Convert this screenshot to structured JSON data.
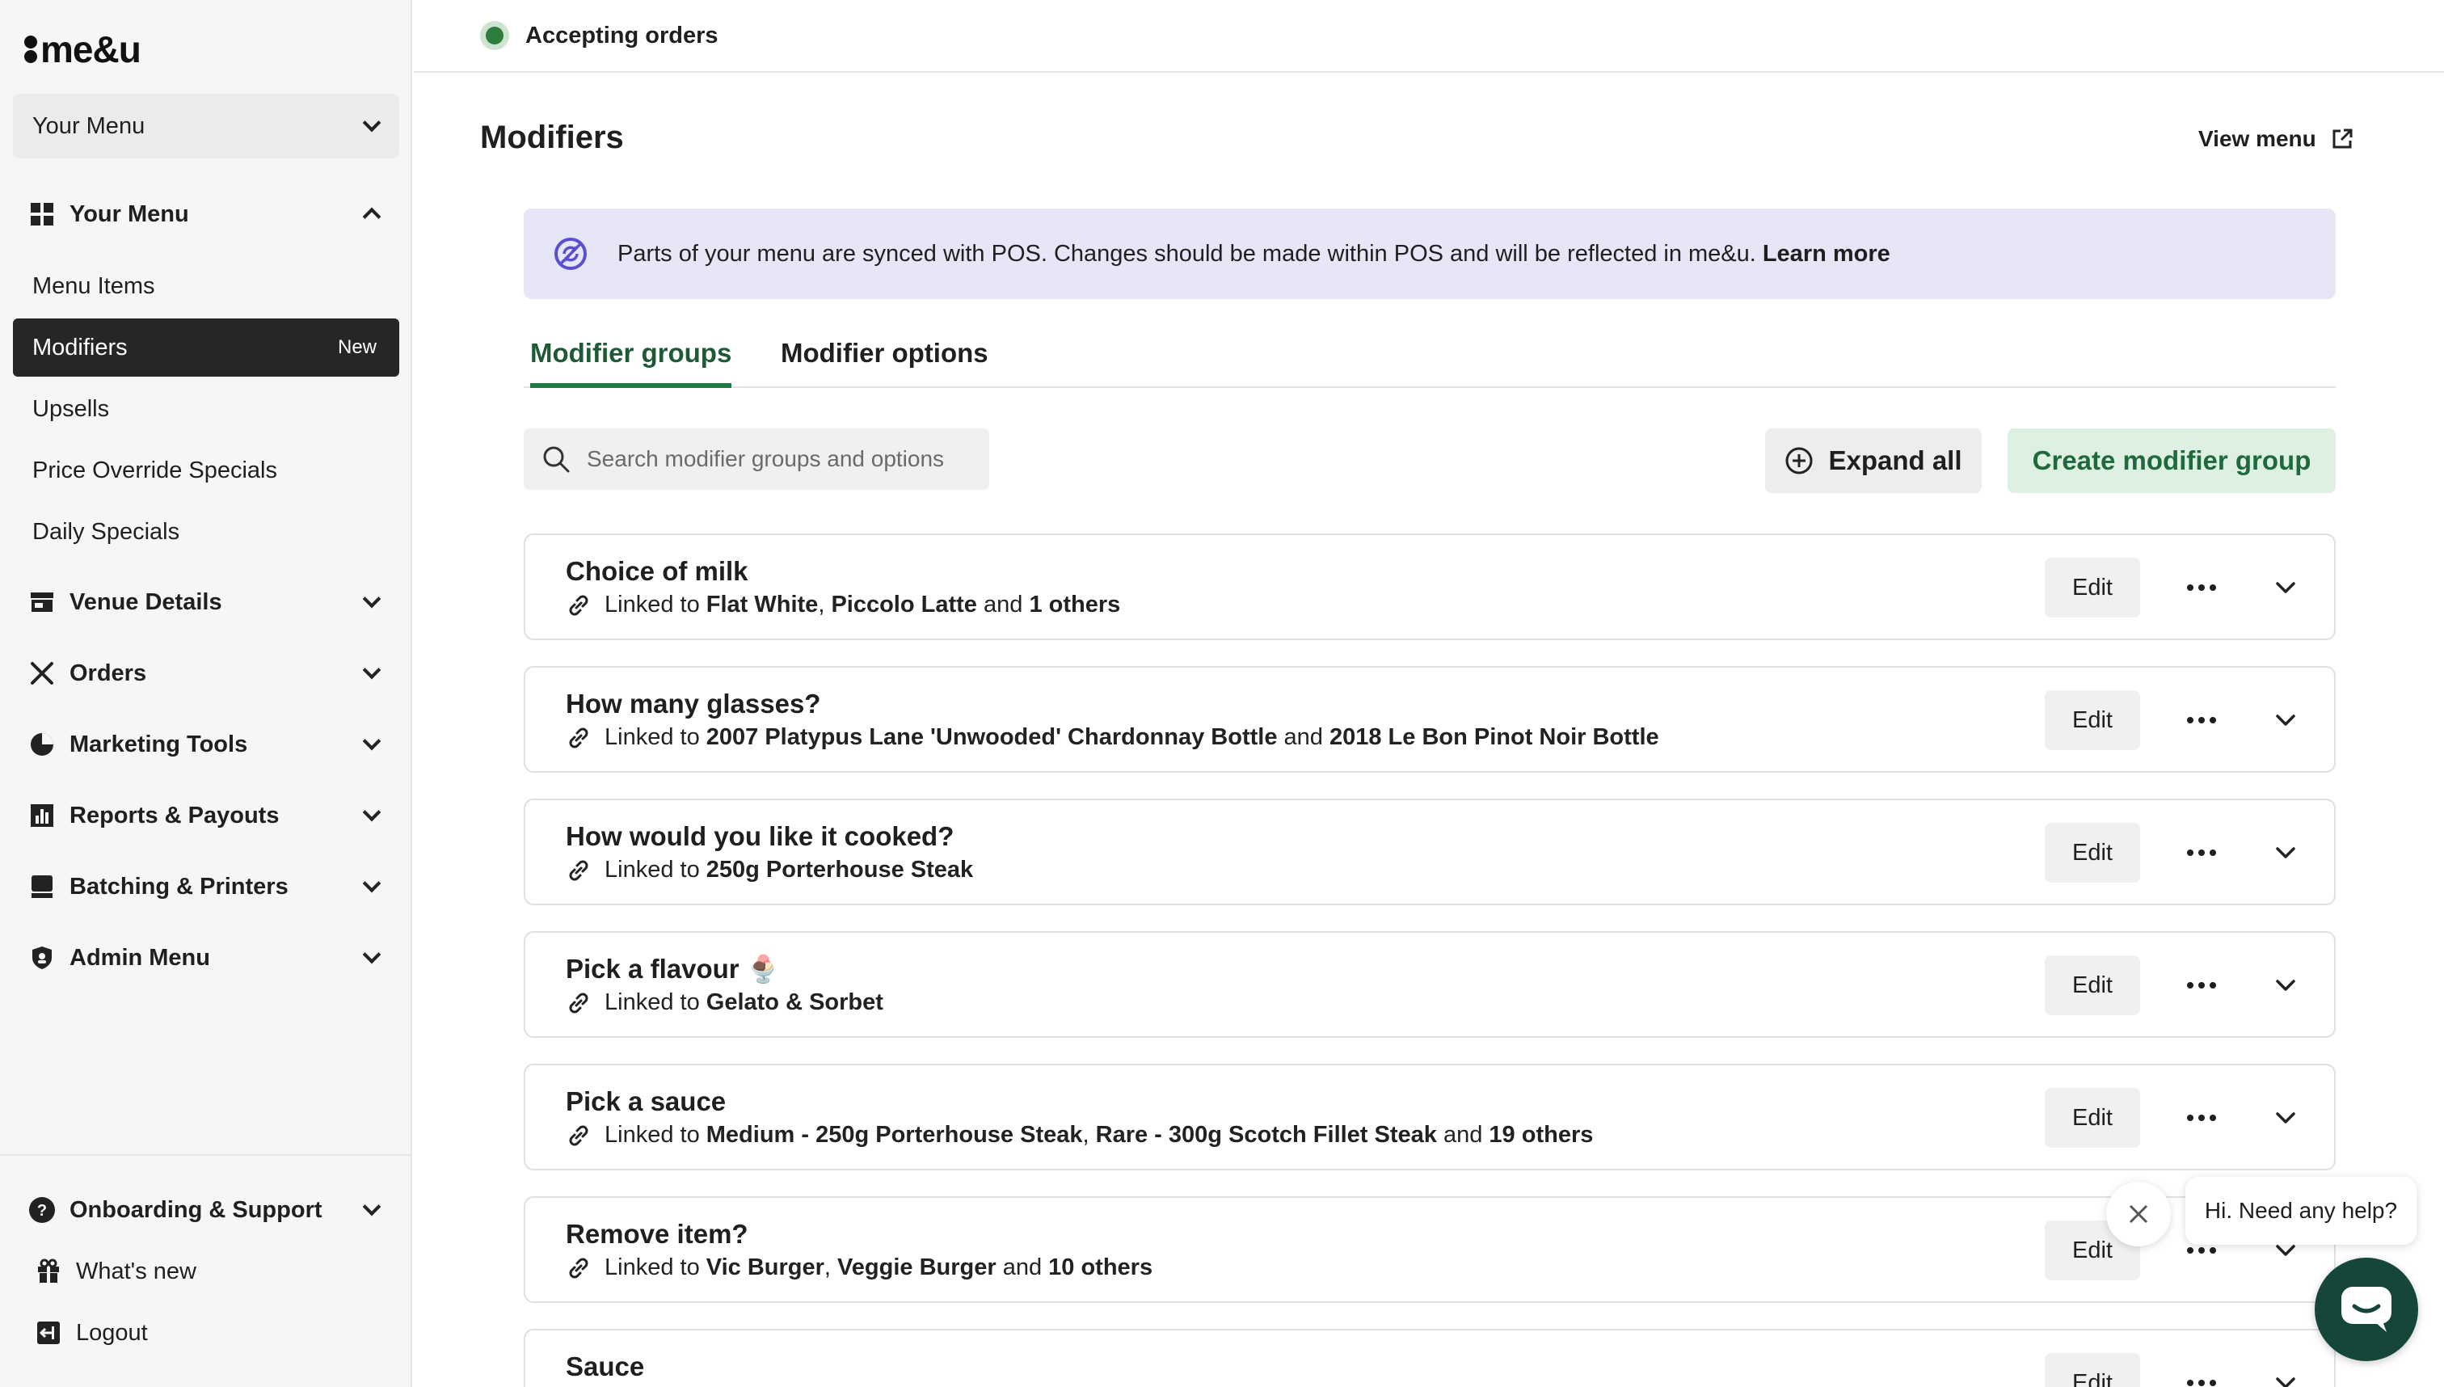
{
  "brand": {
    "logo_text": "me&u"
  },
  "sidebar": {
    "menu_select": "Your Menu",
    "sections": [
      {
        "label": "Your Menu",
        "icon": "grid-icon",
        "expanded": true
      },
      {
        "label": "Venue Details",
        "icon": "storefront-icon"
      },
      {
        "label": "Orders",
        "icon": "utensils-icon"
      },
      {
        "label": "Marketing Tools",
        "icon": "pie-chart-icon"
      },
      {
        "label": "Reports & Payouts",
        "icon": "bar-chart-icon"
      },
      {
        "label": "Batching & Printers",
        "icon": "printer-icon"
      },
      {
        "label": "Admin Menu",
        "icon": "shield-icon"
      }
    ],
    "sub_items": [
      {
        "label": "Menu Items"
      },
      {
        "label": "Modifiers",
        "badge": "New",
        "active": true
      },
      {
        "label": "Upsells"
      },
      {
        "label": "Price Override Specials"
      },
      {
        "label": "Daily Specials"
      }
    ],
    "footer": {
      "support": "Onboarding & Support",
      "whats_new": "What's new",
      "logout": "Logout"
    }
  },
  "topbar": {
    "status": "Accepting orders",
    "status_color": "#2f7d3c"
  },
  "main": {
    "title": "Modifiers",
    "view_menu": "View menu",
    "banner": {
      "text": "Parts of your menu are synced with POS. Changes should be made within POS and will be reflected in me&u.",
      "link": "Learn more"
    },
    "tabs": [
      {
        "label": "Modifier groups",
        "active": true
      },
      {
        "label": "Modifier options"
      }
    ],
    "search_placeholder": "Search modifier groups and options",
    "expand_all": "Expand all",
    "create_button": "Create modifier group",
    "linked_prefix": "Linked to",
    "edit_label": "Edit",
    "groups": [
      {
        "name": "Choice of milk",
        "items": [
          "Flat White",
          "Piccolo Latte"
        ],
        "others": "1 others"
      },
      {
        "name": "How many glasses?",
        "items": [
          "2007 Platypus Lane 'Unwooded' Chardonnay Bottle"
        ],
        "last": "2018 Le Bon Pinot Noir Bottle"
      },
      {
        "name": "How would you like it cooked?",
        "items": [
          "250g Porterhouse Steak"
        ]
      },
      {
        "name": "Pick a flavour 🍨",
        "items": [
          "Gelato & Sorbet"
        ]
      },
      {
        "name": "Pick a sauce",
        "items": [
          "Medium - 250g Porterhouse Steak",
          "Rare - 300g Scotch Fillet Steak"
        ],
        "others": "19 others"
      },
      {
        "name": "Remove item?",
        "items": [
          "Vic Burger",
          "Veggie Burger"
        ],
        "others": "10 others"
      },
      {
        "name": "Sauce",
        "items": []
      }
    ]
  },
  "chat": {
    "bubble": "Hi. Need any help?",
    "accent": "#16463a"
  },
  "colors": {
    "accent_green": "#1e7a45",
    "active_nav": "#262626",
    "banner_bg": "#e6e6f7"
  }
}
